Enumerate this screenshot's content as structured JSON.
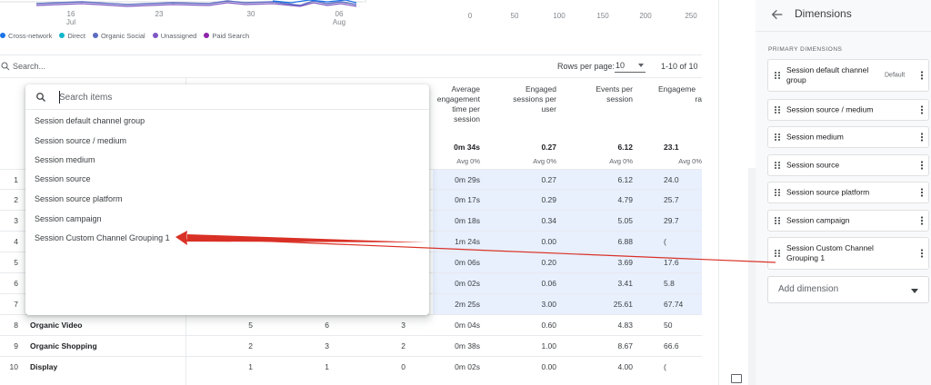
{
  "chart": {
    "x_ticks": [
      {
        "day": "16",
        "month": "Jul"
      },
      {
        "day": "23",
        "month": ""
      },
      {
        "day": "30",
        "month": ""
      },
      {
        "day": "06",
        "month": "Aug"
      }
    ],
    "bar_ticks": [
      "0",
      "50",
      "100",
      "150",
      "200",
      "250"
    ],
    "legend": [
      {
        "label": "Cross-network",
        "color": "#1a73e8"
      },
      {
        "label": "Direct",
        "color": "#12b5cb"
      },
      {
        "label": "Organic Social",
        "color": "#5c6bc0"
      },
      {
        "label": "Unassigned",
        "color": "#7e57c2"
      },
      {
        "label": "Paid Search",
        "color": "#8e24aa"
      }
    ]
  },
  "toolbar": {
    "search_placeholder": "Search...",
    "rows_per_page_label": "Rows per page:",
    "rows_per_page_value": "10",
    "range_text": "1-10 of 10"
  },
  "table": {
    "headers": {
      "avg_engagement": [
        "Average",
        "engagement",
        "time per",
        "session"
      ],
      "engaged_sessions": [
        "Engaged",
        "sessions per",
        "user"
      ],
      "events_per_session": [
        "Events per",
        "session"
      ],
      "engagement_rate": [
        "Engageme",
        "ra"
      ]
    },
    "totals": {
      "avg_engagement": "0m 34s",
      "engaged_sessions": "0.27",
      "events_per_session": "6.12",
      "engagement_rate": "23.1"
    },
    "averages": {
      "avg_engagement": "Avg 0%",
      "engaged_sessions": "Avg 0%",
      "events_per_session": "Avg 0%",
      "engagement_rate": "Avg 0%"
    },
    "rows": [
      {
        "idx": "1",
        "name": "",
        "c1": "",
        "c2": "",
        "c3": "",
        "avg": "0m 29s",
        "eng": "0.27",
        "evt": "6.12",
        "rate": "24.0"
      },
      {
        "idx": "2",
        "name": "",
        "c1": "",
        "c2": "",
        "c3": "",
        "avg": "0m 17s",
        "eng": "0.29",
        "evt": "4.79",
        "rate": "25.7"
      },
      {
        "idx": "3",
        "name": "",
        "c1": "",
        "c2": "",
        "c3": "",
        "avg": "0m 18s",
        "eng": "0.34",
        "evt": "5.05",
        "rate": "29.7"
      },
      {
        "idx": "4",
        "name": "",
        "c1": "",
        "c2": "",
        "c3": "",
        "avg": "1m 24s",
        "eng": "0.00",
        "evt": "6.88",
        "rate": "("
      },
      {
        "idx": "5",
        "name": "",
        "c1": "",
        "c2": "",
        "c3": "",
        "avg": "0m 06s",
        "eng": "0.20",
        "evt": "3.69",
        "rate": "17.6"
      },
      {
        "idx": "6",
        "name": "",
        "c1": "",
        "c2": "",
        "c3": "",
        "avg": "0m 02s",
        "eng": "0.06",
        "evt": "3.41",
        "rate": "5.8"
      },
      {
        "idx": "7",
        "name": "",
        "c1": "",
        "c2": "",
        "c3": "",
        "avg": "2m 25s",
        "eng": "3.00",
        "evt": "25.61",
        "rate": "67.74"
      },
      {
        "idx": "8",
        "name": "Organic Video",
        "c1": "5",
        "c2": "6",
        "c3": "3",
        "avg": "0m 04s",
        "eng": "0.60",
        "evt": "4.83",
        "rate": "50"
      },
      {
        "idx": "9",
        "name": "Organic Shopping",
        "c1": "2",
        "c2": "3",
        "c3": "2",
        "avg": "0m 38s",
        "eng": "1.00",
        "evt": "8.67",
        "rate": "66.6"
      },
      {
        "idx": "10",
        "name": "Display",
        "c1": "1",
        "c2": "1",
        "c3": "0",
        "avg": "0m 02s",
        "eng": "0.00",
        "evt": "4.00",
        "rate": "("
      }
    ]
  },
  "dropdown": {
    "placeholder": "Search items",
    "items": [
      "Session default channel group",
      "Session source / medium",
      "Session medium",
      "Session source",
      "Session source platform",
      "Session campaign",
      "Session Custom Channel Grouping 1"
    ]
  },
  "panel": {
    "title": "Dimensions",
    "section_label": "PRIMARY DIMENSIONS",
    "dimensions": [
      {
        "label": "Session default channel group",
        "badge": "Default"
      },
      {
        "label": "Session source / medium",
        "badge": ""
      },
      {
        "label": "Session medium",
        "badge": ""
      },
      {
        "label": "Session source",
        "badge": ""
      },
      {
        "label": "Session source platform",
        "badge": ""
      },
      {
        "label": "Session campaign",
        "badge": ""
      },
      {
        "label": "Session Custom Channel Grouping 1",
        "badge": ""
      }
    ],
    "add_placeholder": "Add dimension"
  },
  "colors": {
    "accent": "#1a73e8",
    "row_highlight": "#e8f0fe",
    "panel_bg": "#f8f9fa",
    "arrow": "#d93025"
  }
}
